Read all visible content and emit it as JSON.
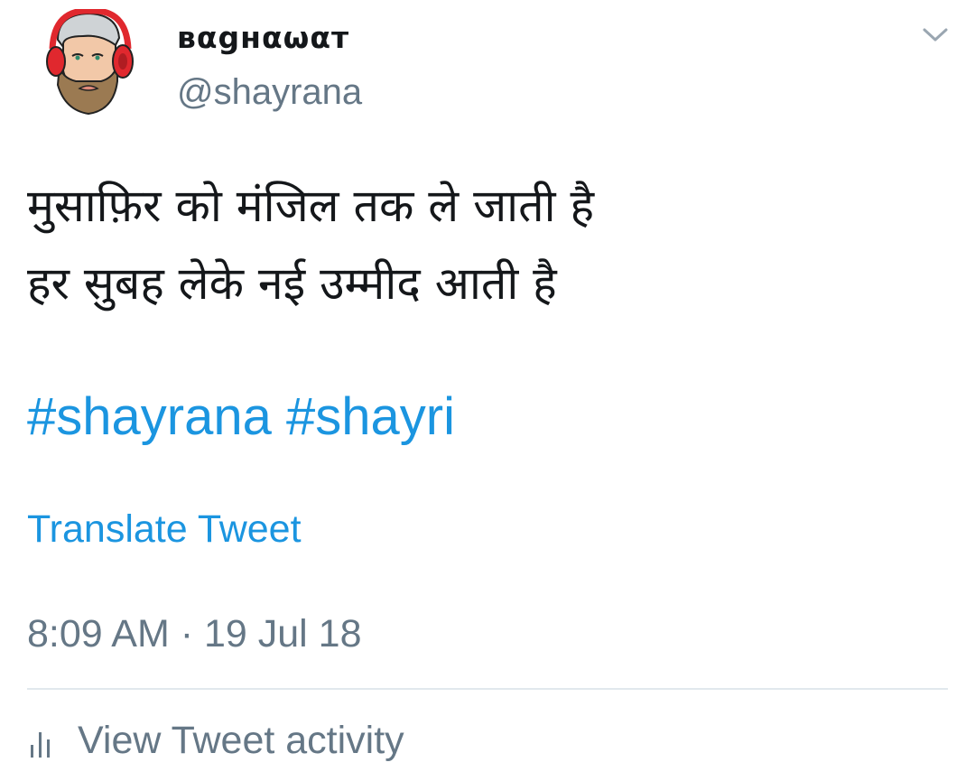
{
  "profile": {
    "display_name": "вαgнαωαт",
    "handle": "@shayrana",
    "avatar_icon": "cartoon-bearded-man-red-headphones"
  },
  "menu": {
    "icon": "chevron-down-icon"
  },
  "tweet": {
    "lines": [
      "मुसाफ़िर को मंजिल तक ले जाती है",
      "हर सुबह लेके नई उम्मीद आती है"
    ],
    "hashtags": [
      "#shayrana",
      "#shayri"
    ],
    "translate_label": "Translate Tweet",
    "timestamp": "8:09 AM · 19 Jul 18"
  },
  "activity": {
    "label": "View Tweet activity",
    "icon": "bar-chart-icon"
  },
  "colors": {
    "link": "#1b95e0",
    "secondary": "#657786",
    "text": "#14171a",
    "divider": "#e1e8ed"
  }
}
